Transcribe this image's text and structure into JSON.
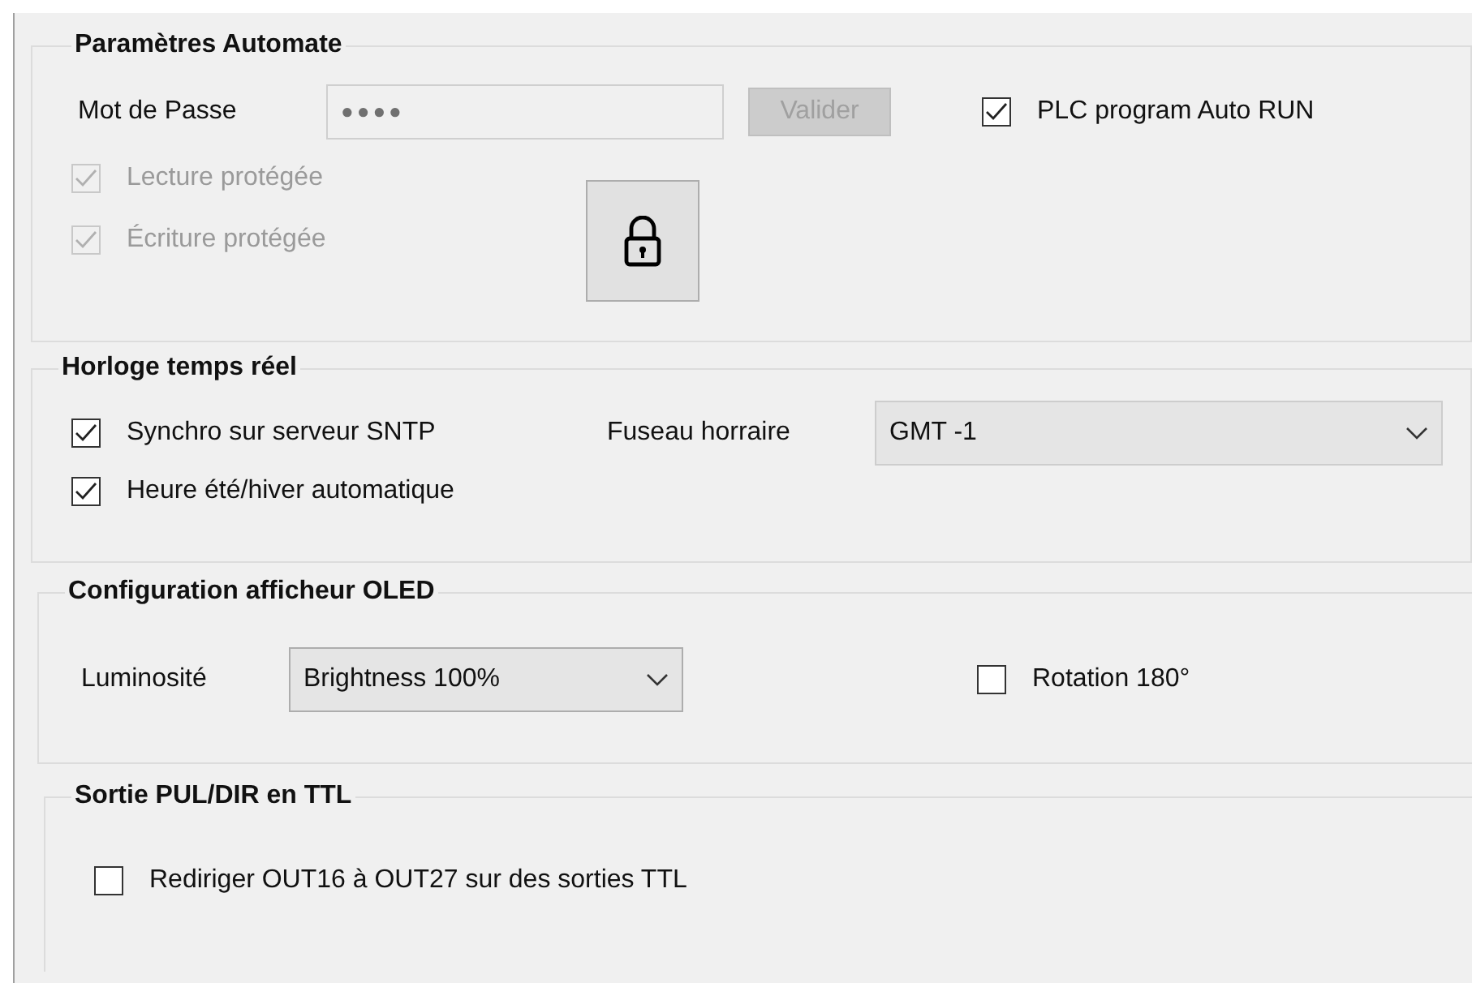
{
  "plc_settings": {
    "title": "Paramètres Automate",
    "password": {
      "label": "Mot de Passe",
      "value": "●●●●"
    },
    "validate_button": {
      "label": "Valider",
      "disabled": true
    },
    "auto_run": {
      "label": "PLC program Auto RUN",
      "checked": true,
      "disabled": false
    },
    "protections": [
      {
        "label": "Lecture protégée",
        "checked": true,
        "disabled": true
      },
      {
        "label": "Écriture protégée",
        "checked": true,
        "disabled": true
      }
    ]
  },
  "clock": {
    "title": "Horloge temps réel",
    "sntp": {
      "label": "Synchro sur serveur SNTP",
      "checked": true,
      "disabled": false
    },
    "dst": {
      "label": "Heure été/hiver automatique",
      "checked": true,
      "disabled": false
    },
    "timezone": {
      "label": "Fuseau horraire",
      "value": "GMT -1"
    }
  },
  "oled": {
    "title": "Configuration afficheur OLED",
    "brightness": {
      "label": "Luminosité",
      "value": "Brightness 100%"
    },
    "rotation": {
      "label": "Rotation 180°",
      "checked": false,
      "disabled": false
    }
  },
  "ttl": {
    "title": "Sortie PUL/DIR en TTL",
    "redirect": {
      "label": "Rediriger OUT16 à OUT27 sur des sorties TTL",
      "checked": false,
      "disabled": false
    }
  }
}
